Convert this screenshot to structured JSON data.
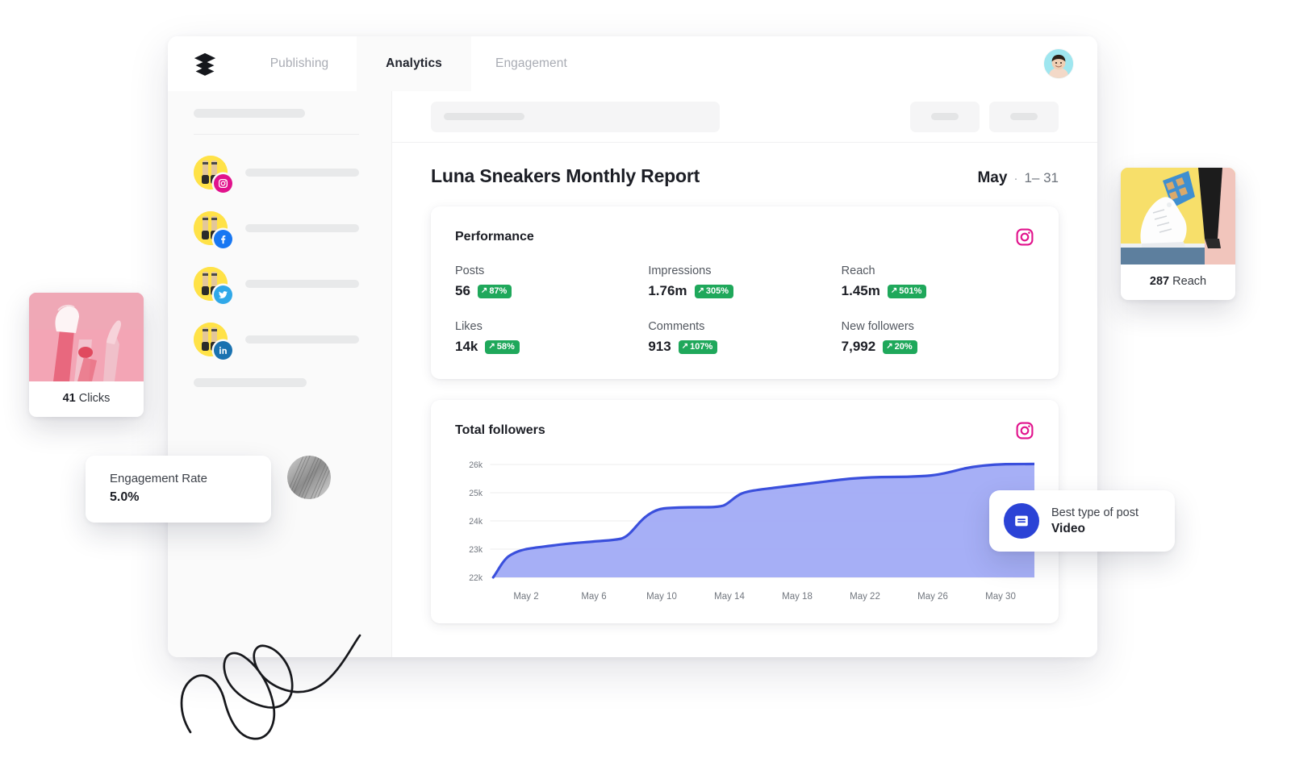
{
  "app": {
    "logo_icon": "buffer-layers-icon",
    "nav_tabs": [
      {
        "label": "Publishing",
        "active": false
      },
      {
        "label": "Analytics",
        "active": true
      },
      {
        "label": "Engagement",
        "active": false
      }
    ],
    "avatar_alt": "user-avatar"
  },
  "sidebar": {
    "accounts": [
      {
        "network": "instagram",
        "network_color": "#e1128c"
      },
      {
        "network": "facebook",
        "network_color": "#1877f2"
      },
      {
        "network": "twitter",
        "network_color": "#30a8e8"
      },
      {
        "network": "linkedin",
        "network_color": "#1a72b0"
      }
    ]
  },
  "report": {
    "title": "Luna Sneakers Monthly Report",
    "month": "May",
    "separator": "·",
    "day_range": "1– 31"
  },
  "performance": {
    "card_title": "Performance",
    "network_icon": "instagram-icon",
    "metrics": [
      {
        "label": "Posts",
        "value": "56",
        "delta": "87%",
        "direction": "up"
      },
      {
        "label": "Impressions",
        "value": "1.76m",
        "delta": "305%",
        "direction": "up"
      },
      {
        "label": "Reach",
        "value": "1.45m",
        "delta": "501%",
        "direction": "up"
      },
      {
        "label": "Likes",
        "value": "14k",
        "delta": "58%",
        "direction": "up"
      },
      {
        "label": "Comments",
        "value": "913",
        "delta": "107%",
        "direction": "up"
      },
      {
        "label": "New followers",
        "value": "7,992",
        "delta": "20%",
        "direction": "up"
      }
    ],
    "delta_color": "#1fa85b"
  },
  "followers_card": {
    "card_title": "Total followers",
    "network_icon": "instagram-icon"
  },
  "chart_data": {
    "type": "area",
    "title": "Total followers",
    "xlabel": "",
    "ylabel": "",
    "ylim": [
      22000,
      26200
    ],
    "ytick_labels": [
      "22k",
      "23k",
      "24k",
      "25k",
      "26k"
    ],
    "ytick_values": [
      22000,
      23000,
      24000,
      25000,
      26000
    ],
    "xtick_labels": [
      "May 2",
      "May 6",
      "May 10",
      "May 14",
      "May 18",
      "May 22",
      "May 26",
      "May 30"
    ],
    "grid": true,
    "legend": "none",
    "line_color": "#3a4fdc",
    "fill_color": "#9ea8f5",
    "x": [
      "May 1",
      "May 2",
      "May 3",
      "May 4",
      "May 5",
      "May 6",
      "May 7",
      "May 8",
      "May 9",
      "May 10",
      "May 11",
      "May 12",
      "May 13",
      "May 14",
      "May 15",
      "May 16",
      "May 17",
      "May 18",
      "May 19",
      "May 20",
      "May 21",
      "May 22",
      "May 23",
      "May 24",
      "May 25",
      "May 26",
      "May 27",
      "May 28",
      "May 29",
      "May 30"
    ],
    "values": [
      22000,
      22620,
      22990,
      23080,
      23150,
      23210,
      23280,
      23350,
      23480,
      23900,
      24420,
      24530,
      24550,
      24560,
      24620,
      24850,
      25010,
      25120,
      25230,
      25330,
      25430,
      25530,
      25590,
      25600,
      25640,
      25710,
      25830,
      25940,
      26000,
      26020
    ]
  },
  "overlays": {
    "clicks_card": {
      "value": "41",
      "label": "Clicks",
      "image": "pink-sneaker-legs-photo"
    },
    "reach_card": {
      "value": "287",
      "label": "Reach",
      "image": "yellow-white-sneaker-photo"
    },
    "engagement_card": {
      "label": "Engagement Rate",
      "value": "5.0%"
    },
    "best_post_card": {
      "label": "Best type of post",
      "value": "Video",
      "icon": "video-post-icon",
      "icon_color": "#2b43d6"
    }
  },
  "decorations": {
    "scribble": "hand-drawn-spiral-scribble",
    "texture_circle": "grayscale-texture-circle"
  }
}
